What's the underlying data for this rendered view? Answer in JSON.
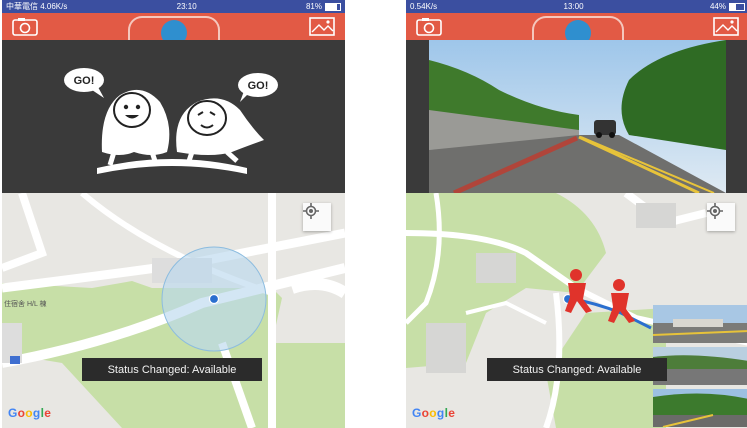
{
  "left_phone": {
    "status": {
      "left": "中華電信 4.06K/s",
      "time": "23:10",
      "right": "81%"
    },
    "map": {
      "label": "住宿舍 H/L 棟",
      "toast": "Status Changed: Available",
      "google": [
        "G",
        "o",
        "o",
        "g",
        "l",
        "e"
      ]
    }
  },
  "right_phone": {
    "status": {
      "left": "0.54K/s",
      "time": "13:00",
      "right": "44%"
    },
    "map": {
      "toast": "Status Changed: Available",
      "google": [
        "G",
        "o",
        "o",
        "g",
        "l",
        "e"
      ]
    }
  },
  "illustration": {
    "bubble_left": "GO!",
    "bubble_right": "GO!"
  },
  "colors": {
    "toolbar": "#e25a45",
    "statusbar": "#3b4fa0",
    "toggle_knob": "#2f8fcf",
    "map_park": "#c7dfa7",
    "path": "#2a6fcf"
  },
  "icons": [
    "camera-icon",
    "gallery-icon",
    "locate-icon",
    "walking-people-icon"
  ]
}
